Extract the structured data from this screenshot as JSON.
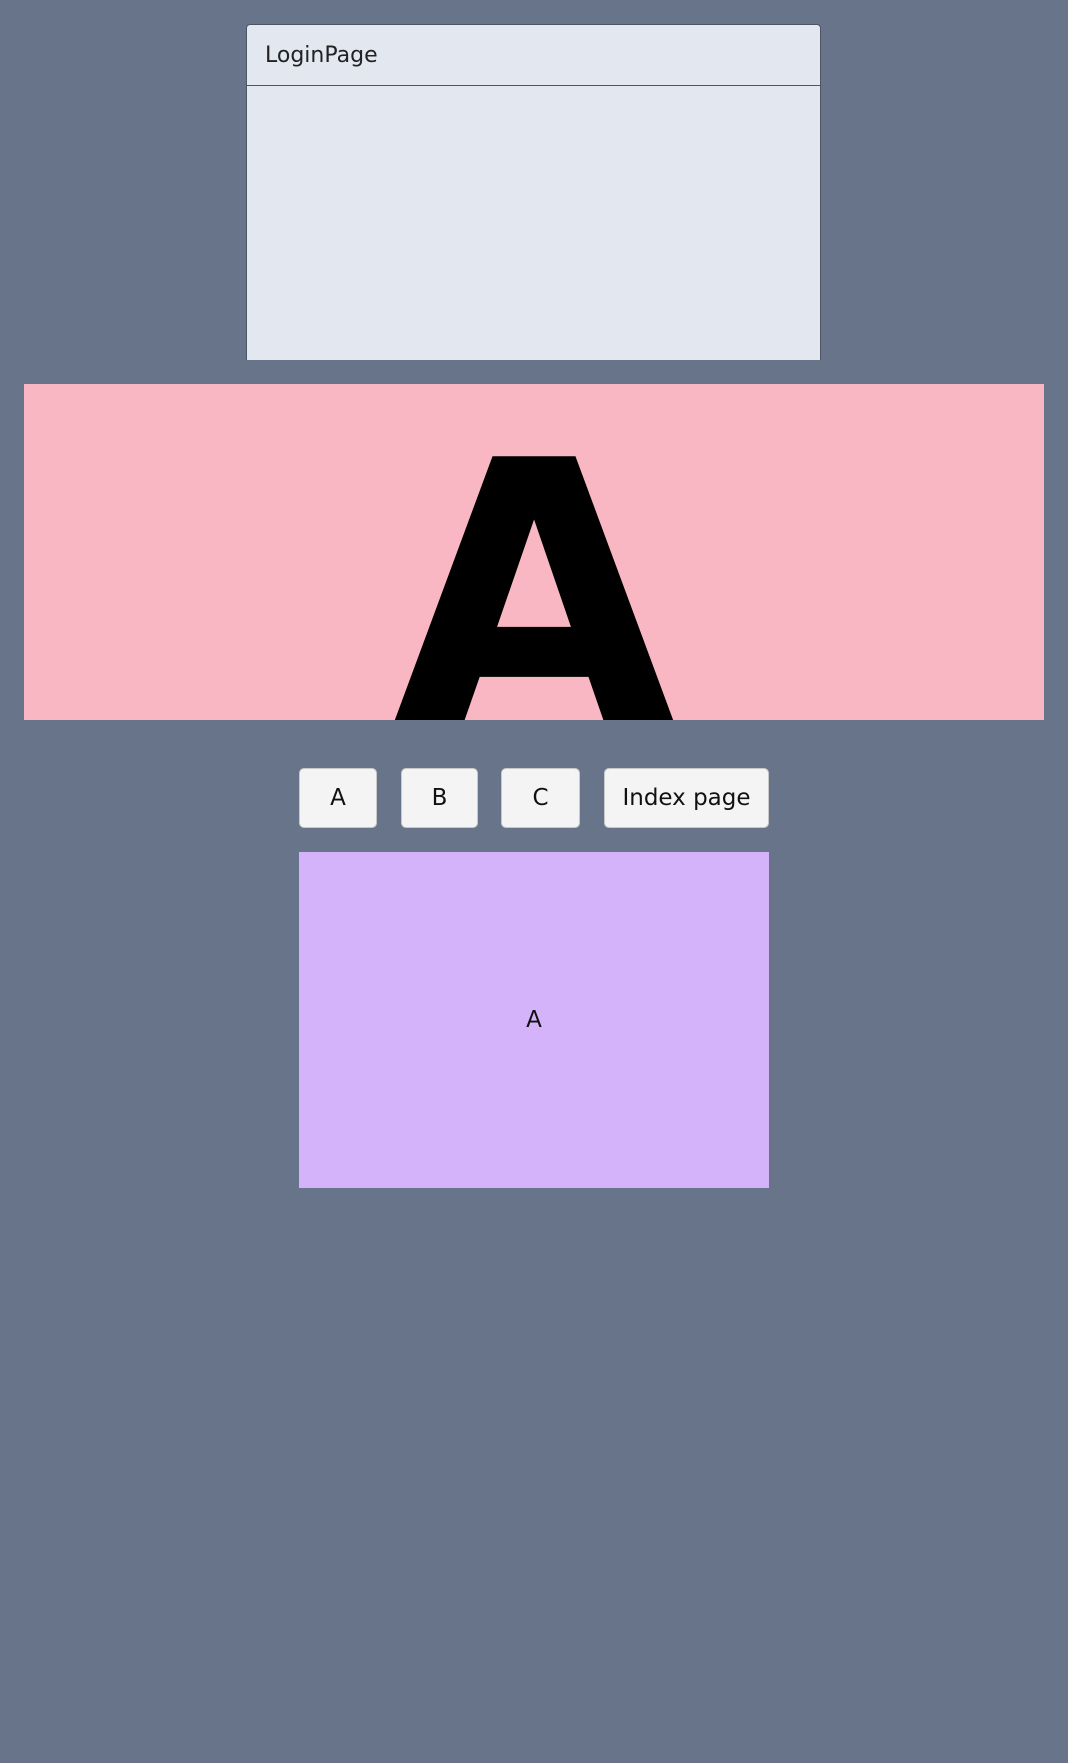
{
  "login_panel": {
    "title": "LoginPage"
  },
  "banner": {
    "letter": "A",
    "background": "#f9b7c4"
  },
  "nav_buttons": {
    "a_label": "A",
    "b_label": "B",
    "c_label": "C",
    "index_label": "Index page"
  },
  "content": {
    "text": "A",
    "background": "#d5b3fb"
  },
  "colors": {
    "page_background": "#687489",
    "panel_background": "#e3e7f0",
    "button_background": "#f4f4f4"
  }
}
